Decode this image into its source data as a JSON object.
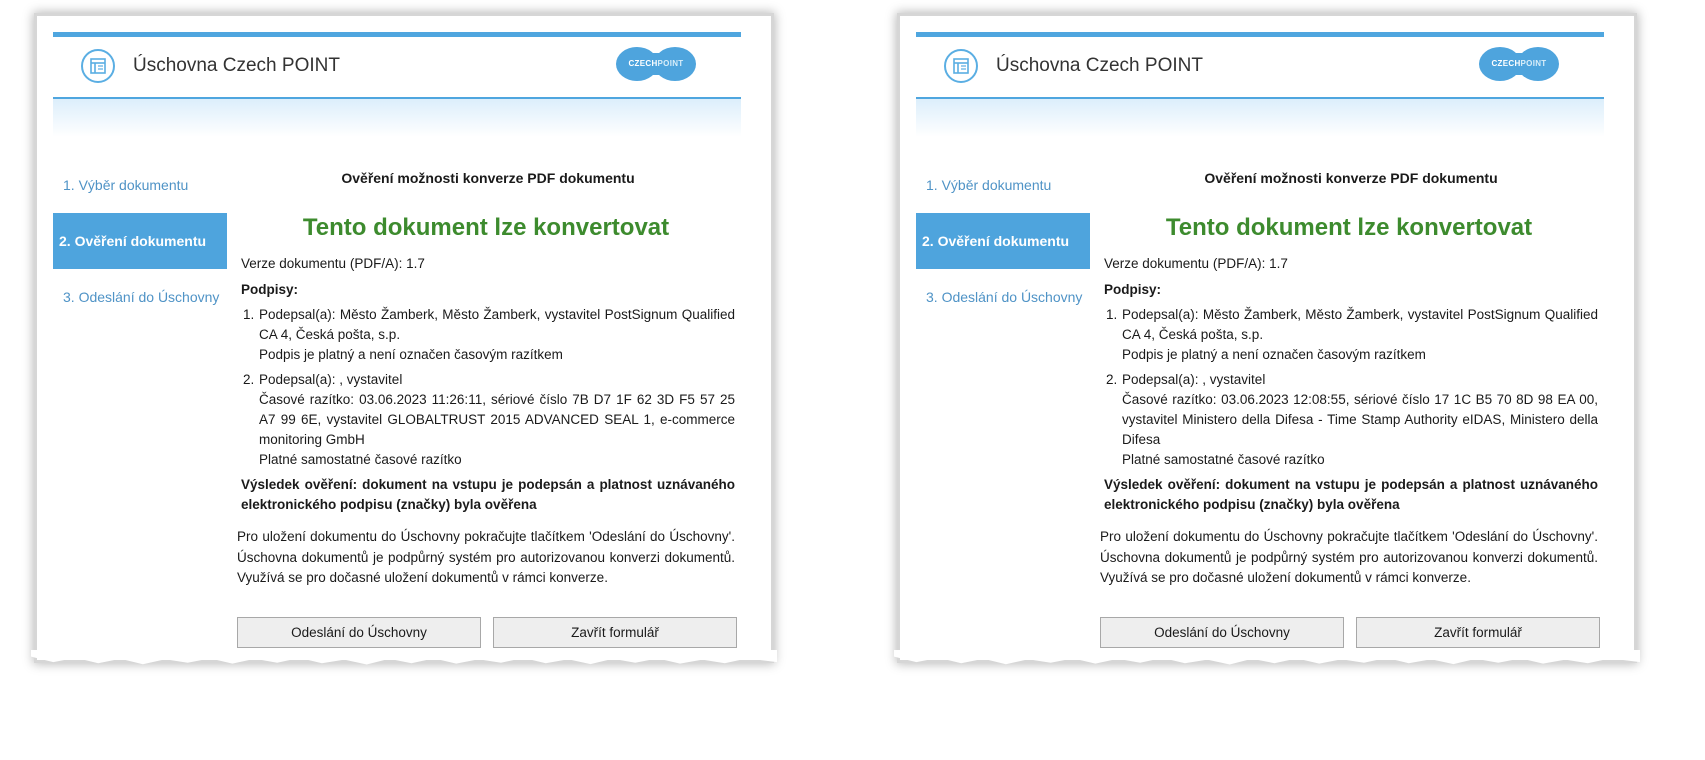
{
  "app": {
    "title": "Úschovna Czech POINT",
    "brand_part1": "CZECH",
    "brand_part2": "POINT"
  },
  "colors": {
    "accent": "#4fa6df",
    "success": "#3d8b2e",
    "brand": "#4ea4dd"
  },
  "sidebar": {
    "items": [
      {
        "label": "1. Výběr dokumentu"
      },
      {
        "label": "2. Ověření dokumentu",
        "active": true
      },
      {
        "label": "3. Odeslání do Úschovny"
      }
    ]
  },
  "main": {
    "section_title": "Ověření možnosti konverze PDF dokumentu",
    "status_heading": "Tento dokument lze konvertovat",
    "version_text": "Verze dokumentu (PDF/A): 1.7",
    "signatures_label": "Podpisy:",
    "result_text": "Výsledek ověření:  dokument na vstupu je podepsán a platnost uznávaného elektronického podpisu (značky) byla ověřena",
    "info_text": "Pro uložení dokumentu do Úschovny pokračujte tlačítkem 'Odeslání do Úschovny'. Úschovna dokumentů je podpůrný systém pro autorizovanou konverzi dokumentů. Využívá se pro dočasné uložení dokumentů v rámci konverze."
  },
  "panels": [
    {
      "signatures": [
        {
          "signer": "Podepsal(a): Město Žamberk, Město Žamberk, vystavitel PostSignum Qualified CA 4, Česká pošta, s.p.",
          "status": "Podpis je platný a není označen časovým razítkem"
        },
        {
          "signer": "Podepsal(a):  , vystavitel",
          "timestamp": "Časové razítko: 03.06.2023 11:26:11, sériové číslo 7B D7 1F 62 3D F5 57 25 A7 99 6E, vystavitel GLOBALTRUST 2015 ADVANCED SEAL 1, e-commerce monitoring GmbH",
          "status": "Platné samostatné časové razítko"
        }
      ]
    },
    {
      "signatures": [
        {
          "signer": "Podepsal(a): Město Žamberk, Město Žamberk, vystavitel PostSignum Qualified CA 4, Česká pošta, s.p.",
          "status": "Podpis je platný a není označen časovým razítkem"
        },
        {
          "signer": "Podepsal(a):  , vystavitel",
          "timestamp": "Časové razítko: 03.06.2023 12:08:55, sériové číslo 17 1C B5 70 8D 98 EA 00, vystavitel Ministero della Difesa - Time Stamp Authority eIDAS, Ministero della Difesa",
          "status": "Platné samostatné časové razítko"
        }
      ]
    }
  ],
  "buttons": {
    "send_label": "Odeslání do Úschovny",
    "close_label": "Zavřít formulář"
  }
}
